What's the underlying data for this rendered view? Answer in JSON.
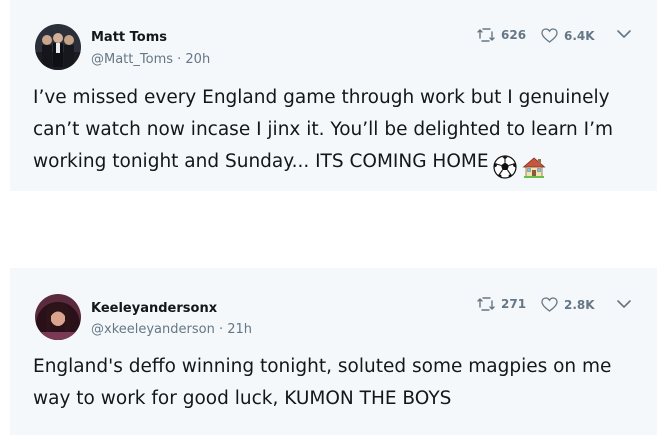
{
  "tweets": [
    {
      "author_name": "Matt Toms",
      "handle_time": "@Matt_Toms · 20h",
      "retweets": "626",
      "likes": "6.4K",
      "text_lines": [
        "I’ve missed every England game through work but I genuinely",
        "can’t watch now incase I jinx it. You’ll be delighted to learn I’m",
        "working tonight and Sunday... ITS COMING HOME"
      ],
      "emoji_icons": [
        "soccer-ball-icon",
        "house-icon"
      ]
    },
    {
      "author_name": "Keeleyandersonx",
      "handle_time": "@xkeeleyanderson · 21h",
      "retweets": "271",
      "likes": "2.8K",
      "text_lines": [
        "England's deffo winning tonight, soluted some magpies on me",
        "way to work for good luck, KUMON THE BOYS"
      ]
    }
  ],
  "colors": {
    "card_bg": "#f5f8fa",
    "text": "#14171a",
    "muted": "#657786"
  }
}
